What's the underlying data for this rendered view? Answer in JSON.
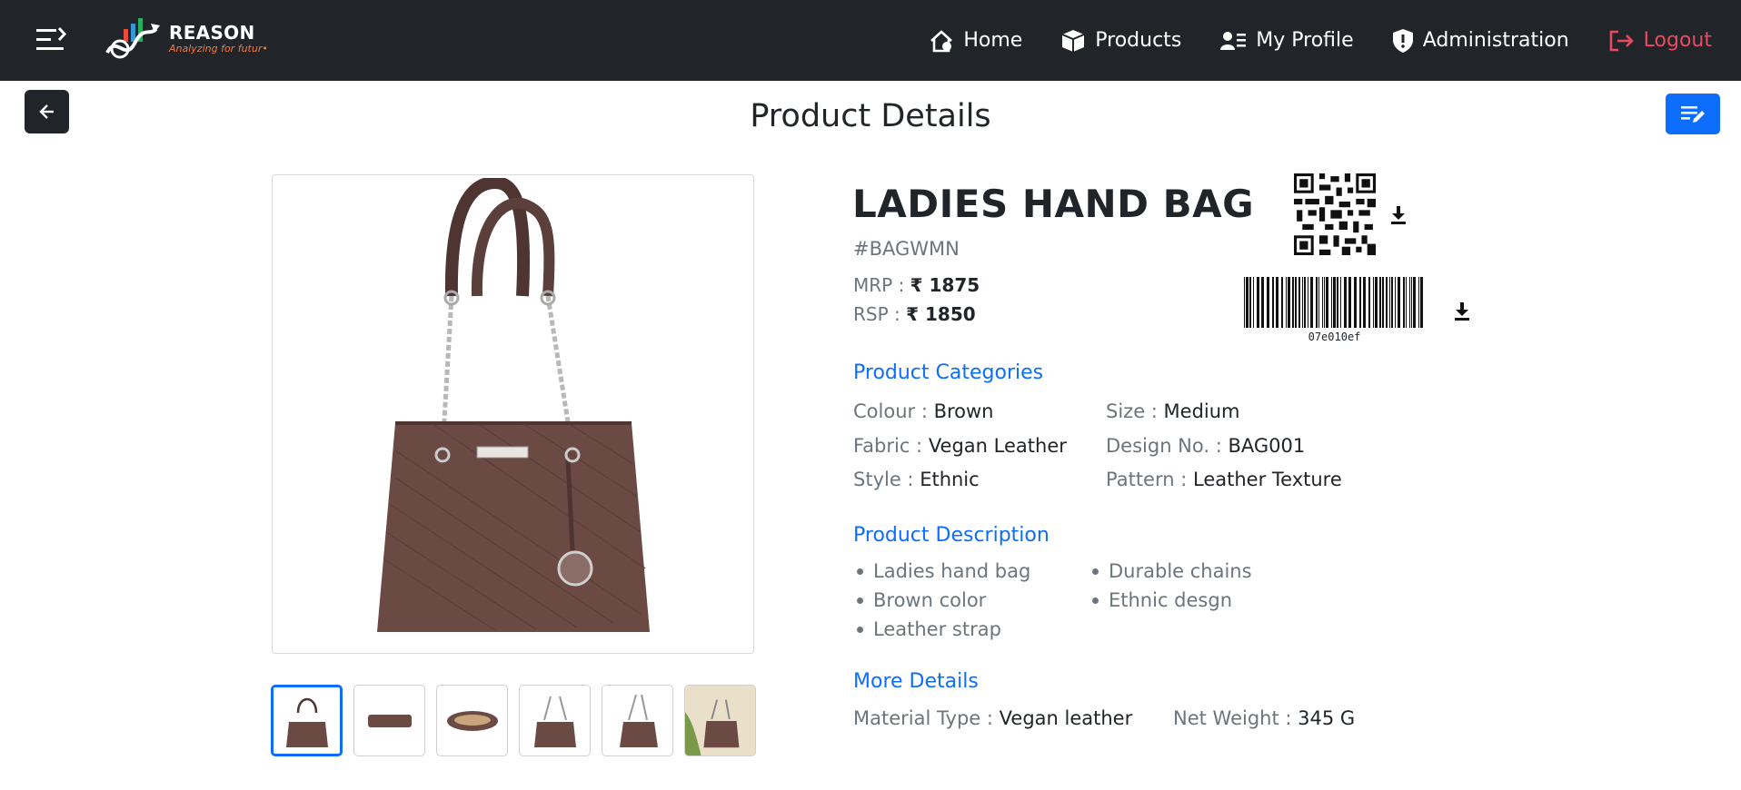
{
  "brand": {
    "name": "REASON",
    "tagline": "Analyzing for futur•"
  },
  "nav": {
    "home": "Home",
    "products": "Products",
    "profile": "My Profile",
    "administration": "Administration",
    "logout": "Logout"
  },
  "page": {
    "title": "Product Details"
  },
  "product": {
    "name": "LADIES HAND BAG",
    "sku": "#BAGWMN",
    "mrp_label": "MRP :",
    "mrp_value": "₹ 1875",
    "rsp_label": "RSP :",
    "rsp_value": "₹ 1850",
    "barcode": "07e010ef"
  },
  "categories": {
    "title": "Product Categories",
    "colour_label": "Colour :",
    "colour": "Brown",
    "size_label": "Size :",
    "size": "Medium",
    "fabric_label": "Fabric :",
    "fabric": "Vegan Leather",
    "design_label": "Design No. :",
    "design": "BAG001",
    "style_label": "Style :",
    "style": "Ethnic",
    "pattern_label": "Pattern :",
    "pattern": "Leather Texture"
  },
  "description": {
    "title": "Product Description",
    "col1": [
      "Ladies hand bag",
      "Brown color",
      "Leather strap"
    ],
    "col2": [
      "Durable chains",
      "Ethnic desgn"
    ]
  },
  "more": {
    "title": "More Details",
    "material_label": "Material Type :",
    "material": "Vegan leather",
    "weight_label": "Net Weight :",
    "weight": "345 G"
  },
  "colors": {
    "navbar": "#212529",
    "accent": "#0d6efd",
    "logout": "#e84a5f",
    "bag": "#6b4a44"
  },
  "icons": [
    "menu-toggle-icon",
    "home-icon",
    "box-icon",
    "profile-icon",
    "shield-icon",
    "logout-icon",
    "arrow-left-icon",
    "edit-note-icon",
    "download-icon",
    "qr-code",
    "barcode"
  ]
}
